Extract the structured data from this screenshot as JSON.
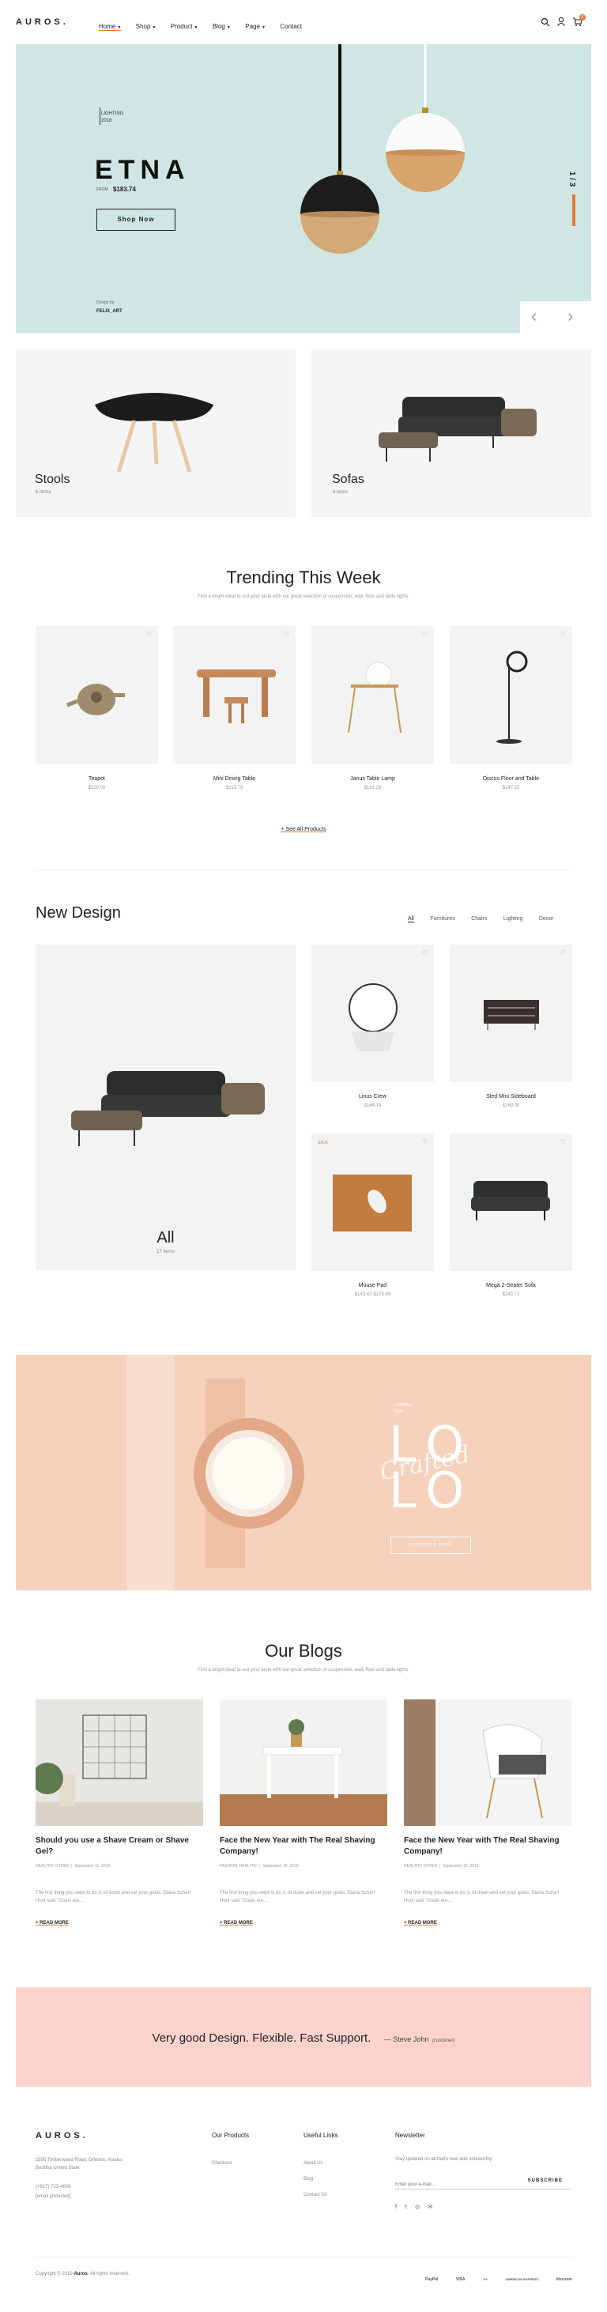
{
  "header": {
    "logo": "AUROS.",
    "nav": [
      {
        "label": "Home",
        "caret": "▼"
      },
      {
        "label": "Shop",
        "caret": "▼"
      },
      {
        "label": "Product",
        "caret": "▼"
      },
      {
        "label": "Blog",
        "caret": "▼"
      },
      {
        "label": "Page",
        "caret": "▼"
      },
      {
        "label": "Contact",
        "caret": ""
      }
    ],
    "cart_count": "0"
  },
  "hero": {
    "label_line1": "LIGHTING",
    "label_line2": "2018",
    "title": "ETNA",
    "price_from": "FROM",
    "price": "$183.74",
    "button": "Shop Now",
    "design_by": "Design by",
    "designer": "FELIX_ART",
    "pager": "1 / 3",
    "prev": "‹",
    "next": "›"
  },
  "categories": [
    {
      "title": "Stools",
      "sub": "6 items"
    },
    {
      "title": "Sofas",
      "sub": "6 items"
    }
  ],
  "trending": {
    "title": "Trending This Week",
    "subtitle": "Find a bright ideal to suit your taste with our great selection of suspension, wall, floor and table lights.",
    "products": [
      {
        "name": "Teapot",
        "price": "$129.00"
      },
      {
        "name": "Mini Dining Table",
        "price": "$213.79"
      },
      {
        "name": "Janus Table Lamp",
        "price": "$161.29"
      },
      {
        "name": "Discus Floor and Table",
        "price": "$147.32"
      }
    ],
    "see_all": "+ See All Products"
  },
  "new_design": {
    "title": "New Design",
    "filters": [
      "All",
      "Furnitures",
      "Chairs",
      "Lighting",
      "Decor"
    ],
    "feature_title": "All",
    "feature_sub": "17 items",
    "products": [
      {
        "name": "Linus Crew",
        "price": "$164.74",
        "badge": ""
      },
      {
        "name": "Sled Mini Sideboard",
        "price": "$169.00",
        "badge": ""
      },
      {
        "name": "Mouse Pad",
        "price": "$143.67-$179.49",
        "badge": "SALE"
      },
      {
        "name": "Mega 2-Seater Sofa",
        "price": "$240.72",
        "badge": ""
      }
    ]
  },
  "lolo": {
    "label_line1": "LIGHTING",
    "label_line2": "2018",
    "letters_top": "LO",
    "letters_bottom": "LO",
    "script": "Crafted",
    "button": "DISCOVER NOW"
  },
  "blogs": {
    "title": "Our Blogs",
    "subtitle": "Find a bright ideal to suit your taste with our great selection of suspension, wall, floor and table lights.",
    "posts": [
      {
        "title": "Should you use a Shave Cream or Shave Gel?",
        "meta_cat": "HEALTHY, OTHER",
        "meta_date": "September 11, 2018",
        "excerpt": "The first thing you need to do is sit down and set your goals. Diana Scharf Hunt said \"Goals are...",
        "read": "+ READ MORE"
      },
      {
        "title": "Face the New Year with The Real Shaving Company!",
        "meta_cat": "FASHION, HEALTHY",
        "meta_date": "September 26, 2018",
        "excerpt": "The first thing you need to do is sit down and set your goals. Diana Scharf Hunt said \"Goals are...",
        "read": "+ READ MORE"
      },
      {
        "title": "Face the New Year with The Real Shaving Company!",
        "meta_cat": "HEALTHY, OTHER",
        "meta_date": "September 18, 2018",
        "excerpt": "The first thing you need to do is sit down and set your goals. Diana Scharf Hunt said \"Goals are...",
        "read": "+ READ MORE"
      }
    ]
  },
  "testimonial": {
    "quote": "Very good Design. Flexible. Fast Support.",
    "author": "— Steve John",
    "role": "(customer)"
  },
  "footer": {
    "logo": "AUROS.",
    "address": "2895 Timberwood Road, Orleans, Alaska Buddha United State",
    "phone": "(+917) 723-4608",
    "email": "[email protected]",
    "col2_title": "Our Products",
    "col2_links": [
      "Checkout"
    ],
    "col3_title": "Useful Links",
    "col3_links": [
      "About Us",
      "Blog",
      "Contact Us"
    ],
    "col4_title": "Newsletter",
    "col4_text": "Stay updated on all that's new add noteworthy",
    "email_placeholder": "Enter your e-mail...",
    "subscribe": "SUBSCRIBE",
    "social": [
      "f",
      "𝕥",
      "◎",
      "✉"
    ],
    "copyright_pre": "Copyright © 2019 ",
    "copyright_brand": "Auros",
    "copyright_post": ". All rights reserved.",
    "payments": [
      "PayPal",
      "VISA",
      "●●",
      "AMERICAN EXPRESS",
      "discover"
    ]
  },
  "colors": {
    "accent": "#e07a3c",
    "hero_bg": "#cfe6e2",
    "lolo_bg": "#f6d1bc",
    "testimonial_bg": "#fbd3cc"
  }
}
